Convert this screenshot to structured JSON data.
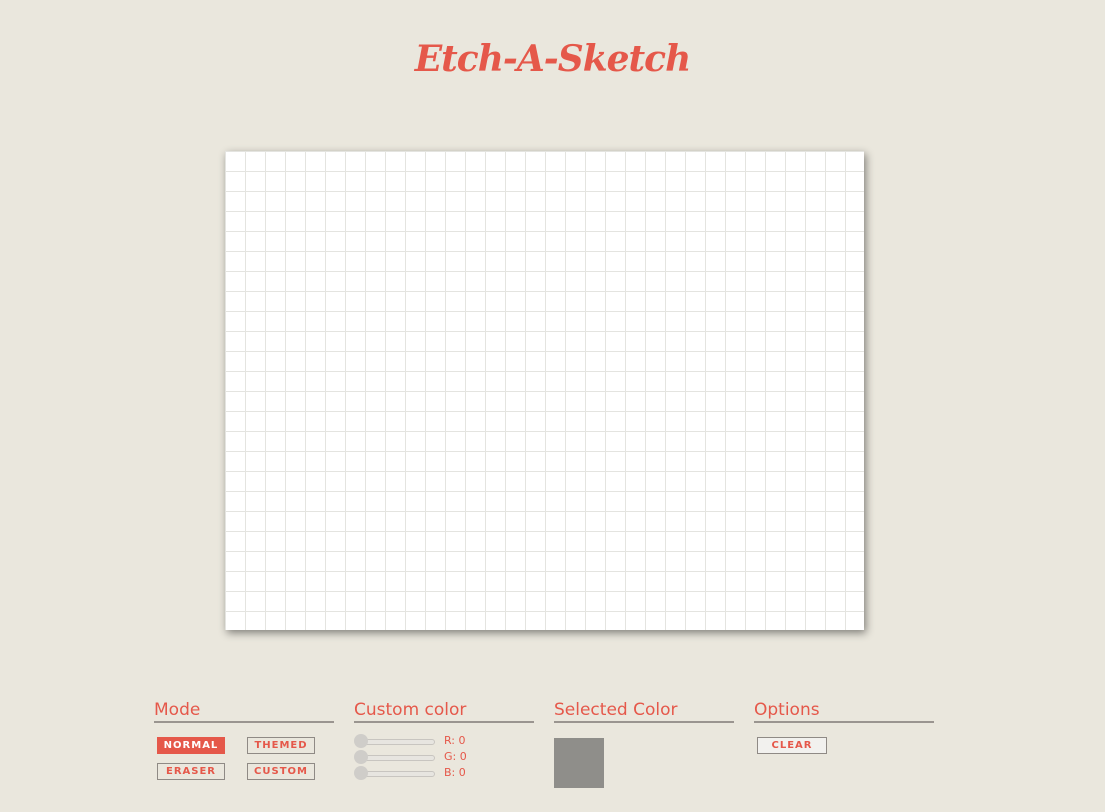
{
  "app": {
    "title": "Etch-A-Sketch"
  },
  "mode": {
    "heading": "Mode",
    "buttons": [
      {
        "label": "NORMAL",
        "active": true
      },
      {
        "label": "THEMED",
        "active": false
      },
      {
        "label": "ERASER",
        "active": false
      },
      {
        "label": "CUSTOM",
        "active": false
      }
    ]
  },
  "custom_color": {
    "heading": "Custom color",
    "sliders": [
      {
        "label": "R: 0",
        "value": 0
      },
      {
        "label": "G: 0",
        "value": 0
      },
      {
        "label": "B: 0",
        "value": 0
      }
    ]
  },
  "selected_color": {
    "heading": "Selected Color",
    "color": "#8f8e8a"
  },
  "options": {
    "heading": "Options",
    "clear_label": "CLEAR"
  },
  "colors": {
    "accent": "#e5584a",
    "background": "#eae7dd",
    "grid_line": "#e4e4e0"
  }
}
